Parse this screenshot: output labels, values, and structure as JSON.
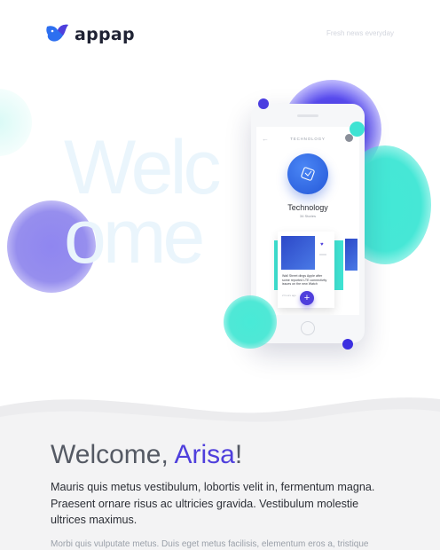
{
  "header": {
    "brand": "appap",
    "tagline": "Fresh news everyday"
  },
  "hero": {
    "watermark_line1": "Welc",
    "watermark_line2": "ome"
  },
  "phone": {
    "header_title": "TECHNOLOGY",
    "category_title": "Technology",
    "category_count": "34 Stories",
    "card_text": "Wall Street dings Apple after some reported LTE connectivity issues on the new Watch",
    "card_meta": "2 hours ago"
  },
  "content": {
    "title_prefix": "Welcome, ",
    "title_name": "Arisa",
    "title_suffix": "!",
    "intro": "Mauris quis metus vestibulum, lobortis velit in, fermentum magna. Praesent ornare risus ac ultricies gravida. Vestibulum molestie ultrices maximus.",
    "body": "Morbi quis vulputate metus. Duis eget metus facilisis, elementum eros a, tristique"
  },
  "colors": {
    "accent": "#4f3fdc",
    "blue": "#2d6ff0",
    "teal": "#3de6d2"
  }
}
